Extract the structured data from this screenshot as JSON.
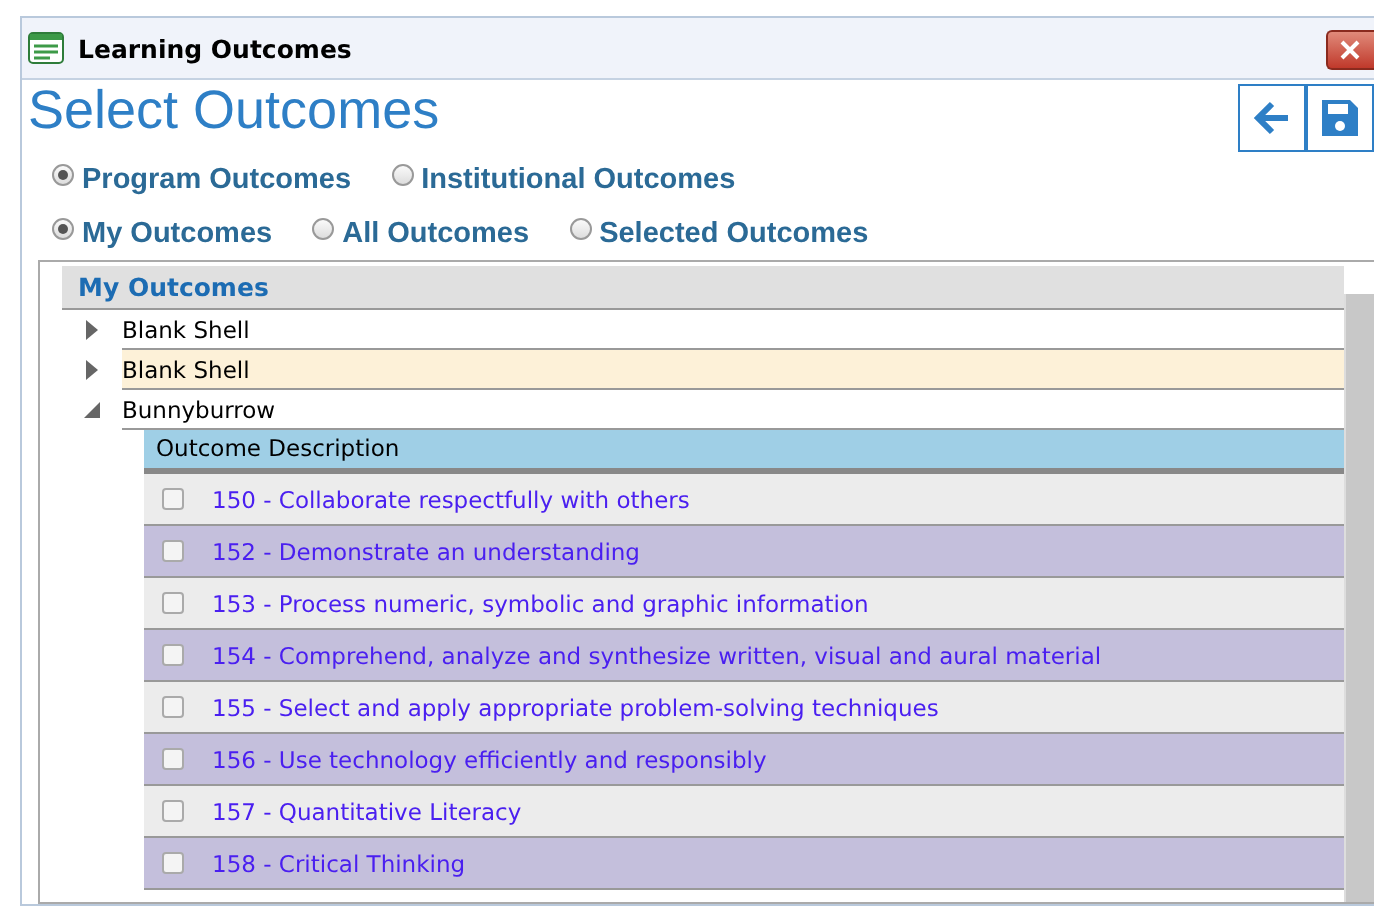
{
  "window": {
    "title": "Learning Outcomes"
  },
  "heading": "Select Outcomes",
  "outcome_types": [
    {
      "label": "Program Outcomes",
      "selected": true
    },
    {
      "label": "Institutional Outcomes",
      "selected": false
    }
  ],
  "outcome_filters": [
    {
      "label": "My Outcomes",
      "selected": true
    },
    {
      "label": "All Outcomes",
      "selected": false
    },
    {
      "label": "Selected Outcomes",
      "selected": false
    }
  ],
  "tree": {
    "header": "My Outcomes",
    "items": [
      {
        "label": "Blank Shell",
        "expanded": false,
        "selected": false
      },
      {
        "label": "Blank Shell",
        "expanded": false,
        "selected": true
      },
      {
        "label": "Bunnyburrow",
        "expanded": true,
        "selected": false,
        "table": {
          "columns": [
            "Outcome Description"
          ],
          "rows": [
            {
              "text": "150 - Collaborate respectfully with others",
              "checked": false
            },
            {
              "text": "152 - Demonstrate an understanding",
              "checked": false
            },
            {
              "text": "153 - Process numeric, symbolic and graphic information",
              "checked": false
            },
            {
              "text": "154 - Comprehend, analyze and synthesize written, visual and aural material",
              "checked": false
            },
            {
              "text": "155 - Select and apply appropriate problem-solving techniques",
              "checked": false
            },
            {
              "text": "156 - Use technology efficiently and responsibly",
              "checked": false
            },
            {
              "text": "157 - Quantitative Literacy",
              "checked": false
            },
            {
              "text": "158 - Critical Thinking",
              "checked": false
            }
          ]
        }
      }
    ]
  }
}
